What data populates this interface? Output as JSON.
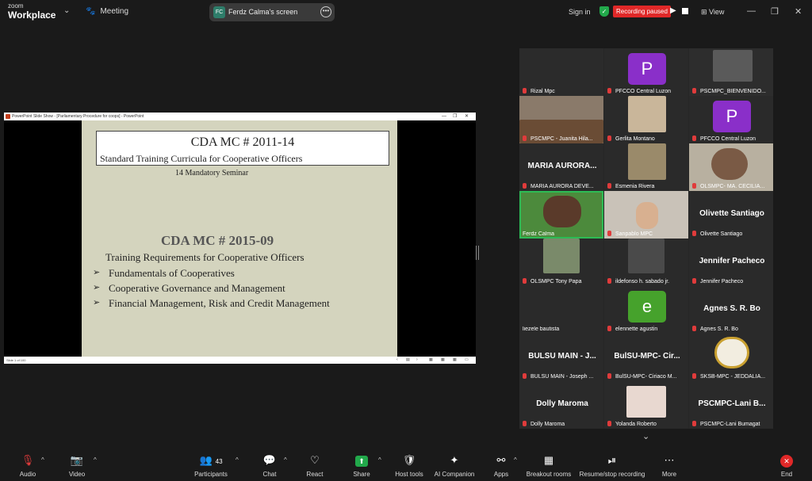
{
  "app": {
    "brand_small": "zoom",
    "brand_big": "Workplace",
    "meeting_label": "Meeting"
  },
  "share": {
    "initials": "FC",
    "label": "Ferdz Calma's screen"
  },
  "header": {
    "sign_in": "Sign in",
    "recording_status": "Recording paused",
    "view": "View"
  },
  "powerpoint": {
    "title_bar": "PowerPoint Slide Show - [Parliamentary Procedure for coops] - PowerPoint",
    "status": "Slide 1 of 100"
  },
  "slide": {
    "box_title": "CDA MC # 2011-14",
    "box_subtitle": "Standard Training Curricula for Cooperative Officers",
    "mandatory": "14 Mandatory Seminar",
    "heading2": "CDA MC # 2015-09",
    "subheading": "Training Requirements for Cooperative Officers",
    "bullets": [
      "Fundamentals of Cooperatives",
      "Cooperative Governance and Management",
      "Financial Management, Risk and Credit Management"
    ]
  },
  "gallery": {
    "tiles": [
      {
        "name": "Rizal Mpc"
      },
      {
        "name": "PFCCO Central Luzon",
        "avatar": "P"
      },
      {
        "name": "PSCMPC_BIENVENIDO..."
      },
      {
        "name": "PSCMPC - Juanita Hila..."
      },
      {
        "name": "Gerlita Montano"
      },
      {
        "name": "PFCCO Central Luzon",
        "avatar": "P"
      },
      {
        "name": "MARIA AURORA DEVE...",
        "big": "MARIA AURORA..."
      },
      {
        "name": "Esmenia Rivera"
      },
      {
        "name": "OLSMPC- MA. CECILIA..."
      },
      {
        "name": "Ferdz Calma"
      },
      {
        "name": "Sanpablo MPC"
      },
      {
        "name": "Olivette Santiago",
        "big": "Olivette Santiago"
      },
      {
        "name": "OLSMPC Tony Papa"
      },
      {
        "name": "ildefonso h. sabado jr."
      },
      {
        "name": "Jennifer Pacheco",
        "big": "Jennifer Pacheco"
      },
      {
        "name": "liezele bautista"
      },
      {
        "name": "elennette agustin",
        "avatar": "e"
      },
      {
        "name": "Agnes S. R. Bo",
        "big": "Agnes S. R. Bo"
      },
      {
        "name": "BULSU MAIN - Joseph ...",
        "big": "BULSU MAIN - J..."
      },
      {
        "name": "BulSU-MPC- Ciriaco M...",
        "big": "BulSU-MPC- Cir..."
      },
      {
        "name": "SKSB-MPC - JEDDALIA..."
      },
      {
        "name": "Dolly Maroma",
        "big": "Dolly Maroma"
      },
      {
        "name": "Yolanda Roberto"
      },
      {
        "name": "PSCMPC-Lani Bumagat",
        "big": "PSCMPC-Lani B..."
      }
    ]
  },
  "toolbar": {
    "audio": "Audio",
    "video": "Video",
    "participants": "Participants",
    "participants_count": "43",
    "chat": "Chat",
    "react": "React",
    "share": "Share",
    "host_tools": "Host tools",
    "ai_companion": "AI Companion",
    "apps": "Apps",
    "breakout_rooms": "Breakout rooms",
    "record": "Resume/stop recording",
    "more": "More",
    "end": "End"
  },
  "colors": {
    "accent_green": "#2dbb55",
    "record_red": "#e02828",
    "avatar_purple": "#8a2fc9",
    "avatar_green": "#46a22c"
  }
}
